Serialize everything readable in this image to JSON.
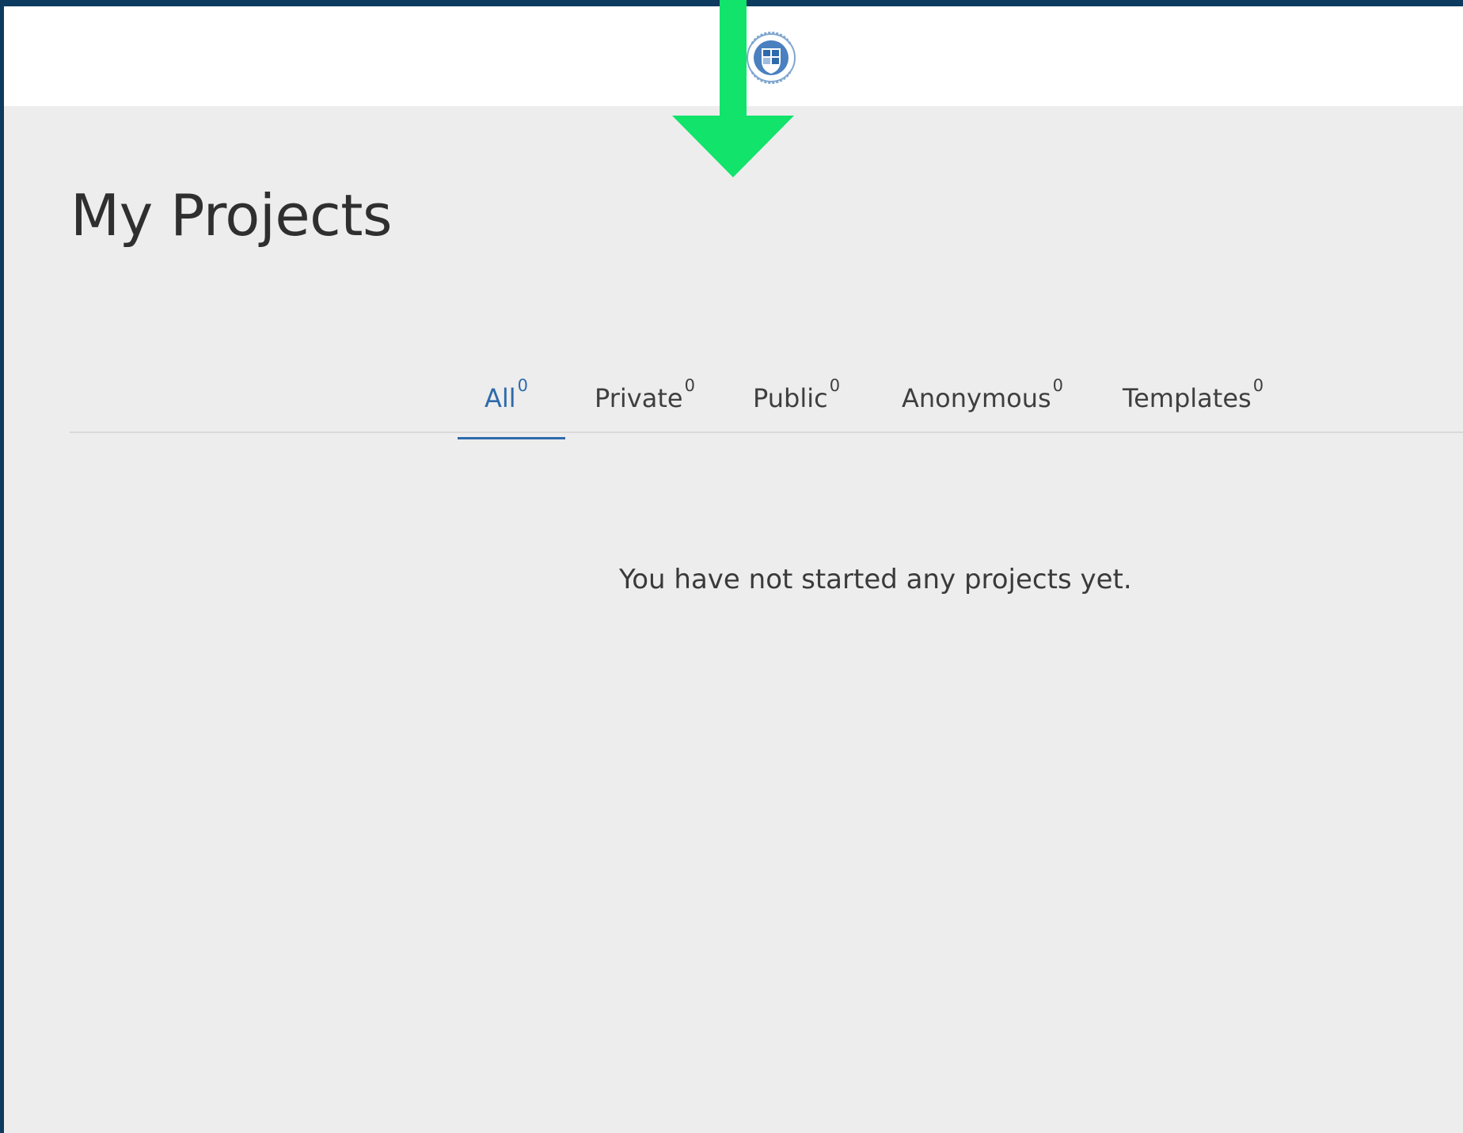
{
  "header": {
    "logo_icon": "academy-seal-icon"
  },
  "page": {
    "title": "My Projects"
  },
  "tabs": [
    {
      "label": "All",
      "count": "0",
      "active": true
    },
    {
      "label": "Private",
      "count": "0",
      "active": false
    },
    {
      "label": "Public",
      "count": "0",
      "active": false
    },
    {
      "label": "Anonymous",
      "count": "0",
      "active": false
    },
    {
      "label": "Templates",
      "count": "0",
      "active": false
    }
  ],
  "main": {
    "empty_message": "You have not started any projects yet."
  },
  "annotation": {
    "icon": "down-arrow-icon",
    "color": "#11e36b"
  },
  "colors": {
    "frame": "#0d3a5f",
    "accent": "#2e6aab",
    "background": "#ededed"
  }
}
